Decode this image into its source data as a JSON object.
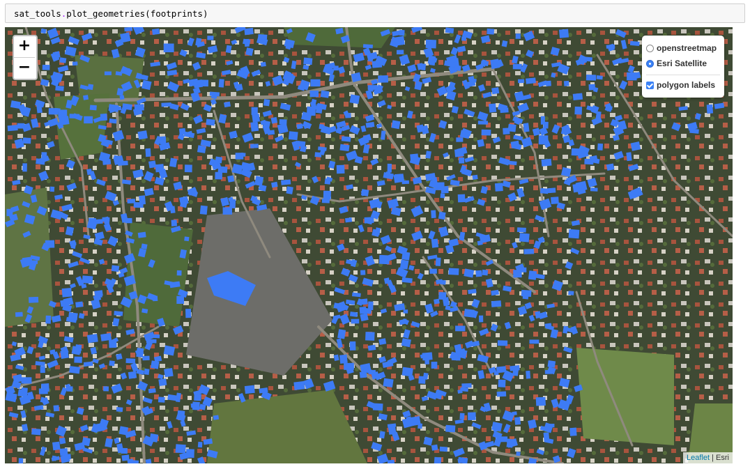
{
  "code": {
    "module": "sat_tools",
    "function": "plot_geometries",
    "argument": "footprints"
  },
  "map": {
    "zoom_in_label": "+",
    "zoom_out_label": "−",
    "layers": {
      "base_layers": [
        {
          "label": "openstreetmap",
          "selected": false
        },
        {
          "label": "Esri Satellite",
          "selected": true
        }
      ],
      "overlays": [
        {
          "label": "polygon labels",
          "checked": true
        }
      ]
    },
    "attribution": {
      "leaflet": "Leaflet",
      "separator": " | ",
      "provider": "Esri"
    },
    "colors": {
      "footprint_fill": "#3d7bf5",
      "imagery_dark": "#3e4a33",
      "field_green": "#5d7140",
      "road": "#8f8a7e",
      "radio_selected": "#3b82f6",
      "attribution_link": "#0078a8"
    }
  }
}
